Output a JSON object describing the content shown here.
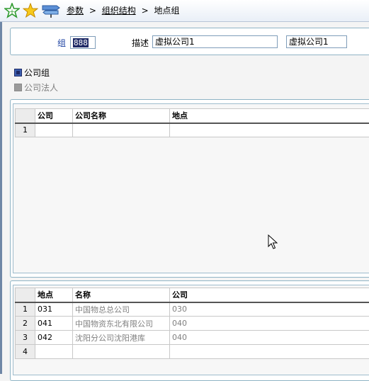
{
  "toolbar": {
    "icons": [
      "favorite-add-icon",
      "favorite-icon",
      "signpost-icon"
    ]
  },
  "breadcrumb": {
    "items": [
      "参数",
      "组织结构"
    ],
    "current": "地点组",
    "separator": ">"
  },
  "form": {
    "group_label": "组",
    "group_value": "888",
    "desc_label": "描述",
    "desc_value": "虚拟公司1",
    "desc_short_value": "虚拟公司1"
  },
  "options": [
    {
      "label": "公司组",
      "selected": true
    },
    {
      "label": "公司法人",
      "selected": false
    }
  ],
  "company_grid": {
    "columns": [
      "公司",
      "公司名称",
      "地点"
    ],
    "rows": [
      {
        "no": "1",
        "cells": [
          "",
          "",
          ""
        ]
      }
    ]
  },
  "site_grid": {
    "columns": [
      "地点",
      "名称",
      "公司"
    ],
    "rows": [
      {
        "no": "1",
        "cells": [
          "031",
          "中国物总总公司",
          "030"
        ]
      },
      {
        "no": "2",
        "cells": [
          "041",
          "中国物资东北有限公司",
          "040"
        ]
      },
      {
        "no": "3",
        "cells": [
          "042",
          "沈阳分公司沈阳港库",
          "040"
        ]
      },
      {
        "no": "4",
        "cells": [
          "",
          "",
          ""
        ]
      }
    ]
  },
  "colors": {
    "accent": "#1f2a66",
    "panel_border": "#8fb4c5",
    "link_label": "#1a3fa0",
    "grey_text": "#808080"
  }
}
